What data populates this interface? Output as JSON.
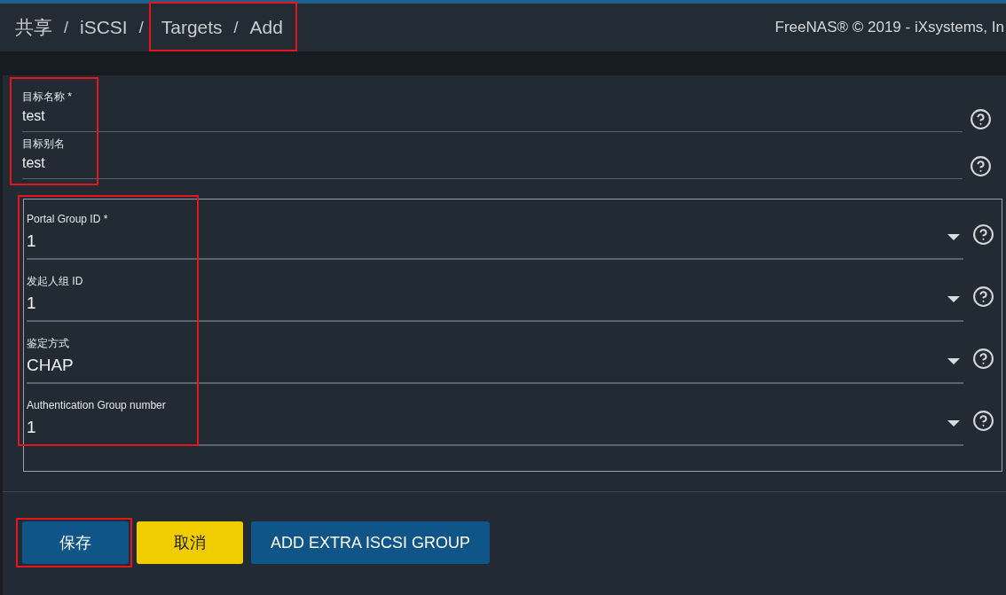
{
  "header": {
    "breadcrumb": [
      {
        "highlighted": false,
        "items": [
          "共享",
          "iSCSI"
        ]
      },
      {
        "highlighted": true,
        "items": [
          "Targets",
          "Add"
        ]
      }
    ],
    "separator": "/",
    "copyright": "FreeNAS® © 2019 - iXsystems, In"
  },
  "text_fields": {
    "highlighted": true,
    "items": [
      {
        "label": "目标名称 *",
        "value": "test"
      },
      {
        "label": "目标别名",
        "value": "test"
      }
    ]
  },
  "group": {
    "highlighted": true,
    "selects": [
      {
        "label": "Portal Group ID *",
        "value": "1"
      },
      {
        "label": "发起人组 ID",
        "value": "1"
      },
      {
        "label": "鉴定方式",
        "value": "CHAP"
      },
      {
        "label": "Authentication Group number",
        "value": "1"
      }
    ]
  },
  "buttons": [
    {
      "label": "保存",
      "kind": "primary",
      "highlighted": true
    },
    {
      "label": "取消",
      "kind": "warning",
      "highlighted": false
    },
    {
      "label": "ADD EXTRA ISCSI GROUP",
      "kind": "primary",
      "highlighted": false
    }
  ]
}
